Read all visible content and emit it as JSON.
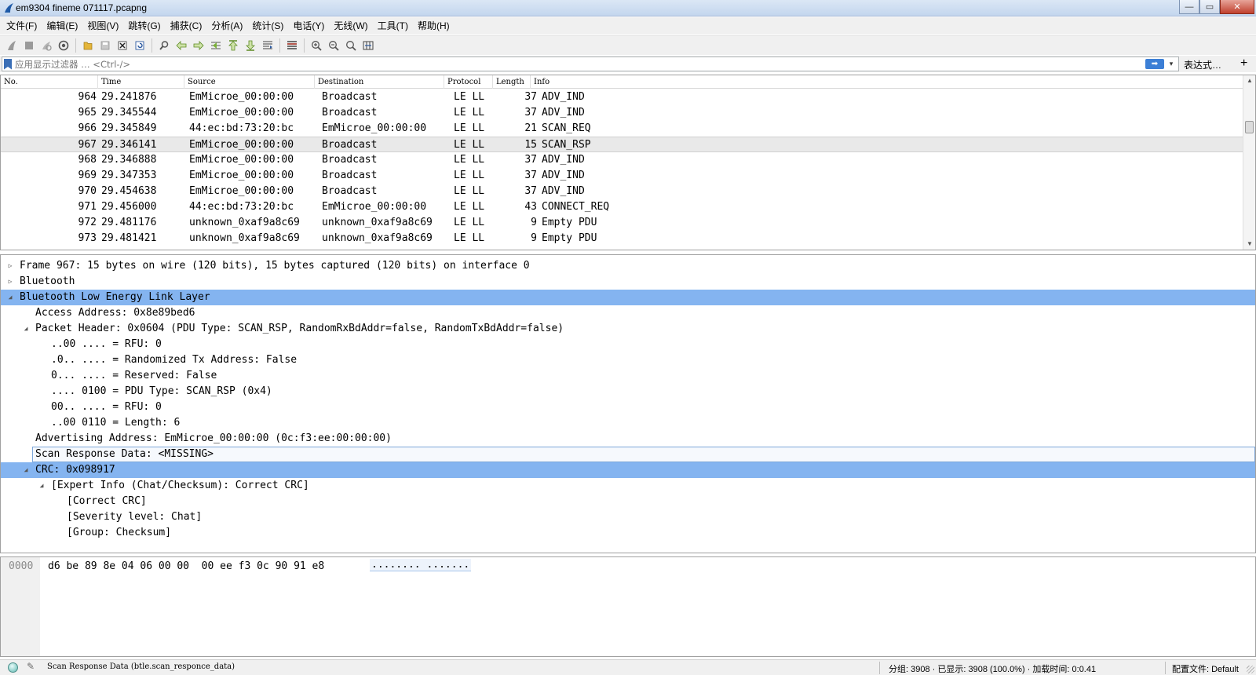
{
  "window": {
    "title": "em9304 fineme 071117.pcapng",
    "minimize": "—",
    "maximize": "▭",
    "close": "✕"
  },
  "menu": [
    "文件(F)",
    "编辑(E)",
    "视图(V)",
    "跳转(G)",
    "捕获(C)",
    "分析(A)",
    "统计(S)",
    "电话(Y)",
    "无线(W)",
    "工具(T)",
    "帮助(H)"
  ],
  "filter": {
    "placeholder": "应用显示过滤器 … <Ctrl-/>",
    "apply_label": "➡",
    "dropdown": "▾",
    "expression_label": "表达式…",
    "add_label": "+"
  },
  "packet_list": {
    "columns": [
      "No.",
      "Time",
      "Source",
      "Destination",
      "Protocol",
      "Length",
      "Info"
    ],
    "rows": [
      {
        "no": "964",
        "time": "29.241876",
        "source": "EmMicroe_00:00:00",
        "destination": "Broadcast",
        "protocol": "LE LL",
        "length": "37",
        "info": "ADV_IND"
      },
      {
        "no": "965",
        "time": "29.345544",
        "source": "EmMicroe_00:00:00",
        "destination": "Broadcast",
        "protocol": "LE LL",
        "length": "37",
        "info": "ADV_IND"
      },
      {
        "no": "966",
        "time": "29.345849",
        "source": "44:ec:bd:73:20:bc",
        "destination": "EmMicroe_00:00:00",
        "protocol": "LE LL",
        "length": "21",
        "info": "SCAN_REQ"
      },
      {
        "no": "967",
        "time": "29.346141",
        "source": "EmMicroe_00:00:00",
        "destination": "Broadcast",
        "protocol": "LE LL",
        "length": "15",
        "info": "SCAN_RSP"
      },
      {
        "no": "968",
        "time": "29.346888",
        "source": "EmMicroe_00:00:00",
        "destination": "Broadcast",
        "protocol": "LE LL",
        "length": "37",
        "info": "ADV_IND"
      },
      {
        "no": "969",
        "time": "29.347353",
        "source": "EmMicroe_00:00:00",
        "destination": "Broadcast",
        "protocol": "LE LL",
        "length": "37",
        "info": "ADV_IND"
      },
      {
        "no": "970",
        "time": "29.454638",
        "source": "EmMicroe_00:00:00",
        "destination": "Broadcast",
        "protocol": "LE LL",
        "length": "37",
        "info": "ADV_IND"
      },
      {
        "no": "971",
        "time": "29.456000",
        "source": "44:ec:bd:73:20:bc",
        "destination": "EmMicroe_00:00:00",
        "protocol": "LE LL",
        "length": "43",
        "info": "CONNECT_REQ"
      },
      {
        "no": "972",
        "time": "29.481176",
        "source": "unknown_0xaf9a8c69",
        "destination": "unknown_0xaf9a8c69",
        "protocol": "LE LL",
        "length": "9",
        "info": "Empty PDU"
      },
      {
        "no": "973",
        "time": "29.481421",
        "source": "unknown_0xaf9a8c69",
        "destination": "unknown_0xaf9a8c69",
        "protocol": "LE LL",
        "length": "9",
        "info": "Empty PDU"
      }
    ],
    "selected_no": "967"
  },
  "details": [
    {
      "text": "Frame 967: 15 bytes on wire (120 bits), 15 bytes captured (120 bits) on interface 0",
      "twisty": "▷",
      "level": 0
    },
    {
      "text": "Bluetooth",
      "twisty": "▷",
      "level": 0
    },
    {
      "text": "Bluetooth Low Energy Link Layer",
      "twisty": "◢",
      "level": 0,
      "highlight": true
    },
    {
      "text": "Access Address: 0x8e89bed6",
      "twisty": "",
      "level": 1
    },
    {
      "text": "Packet Header: 0x0604 (PDU Type: SCAN_RSP, RandomRxBdAddr=false, RandomTxBdAddr=false)",
      "twisty": "◢",
      "level": 1
    },
    {
      "text": "..00 .... = RFU: 0",
      "twisty": "",
      "level": 2
    },
    {
      "text": ".0.. .... = Randomized Tx Address: False",
      "twisty": "",
      "level": 2
    },
    {
      "text": "0... .... = Reserved: False",
      "twisty": "",
      "level": 2
    },
    {
      "text": ".... 0100 = PDU Type: SCAN_RSP (0x4)",
      "twisty": "",
      "level": 2
    },
    {
      "text": "00.. .... = RFU: 0",
      "twisty": "",
      "level": 2
    },
    {
      "text": "..00 0110 = Length: 6",
      "twisty": "",
      "level": 2
    },
    {
      "text": "Advertising Address: EmMicroe_00:00:00 (0c:f3:ee:00:00:00)",
      "twisty": "",
      "level": 1
    },
    {
      "text": "Scan Response Data: <MISSING>",
      "twisty": "",
      "level": 1,
      "focus": true
    },
    {
      "text": "CRC: 0x098917",
      "twisty": "◢",
      "level": 1,
      "highlight": true
    },
    {
      "text": "[Expert Info (Chat/Checksum): Correct CRC]",
      "twisty": "◢",
      "level": 2
    },
    {
      "text": "[Correct CRC]",
      "twisty": "",
      "level": 3
    },
    {
      "text": "[Severity level: Chat]",
      "twisty": "",
      "level": 3
    },
    {
      "text": "[Group: Checksum]",
      "twisty": "",
      "level": 3
    }
  ],
  "bytes": {
    "offset": "0000",
    "hex": "d6 be 89 8e 04 06 00 00  00 ee f3 0c 90 91 e8",
    "ascii": "........ ......."
  },
  "status": {
    "field_text": "Scan Response Data (btle.scan_responce_data)",
    "stats": "分组: 3908 · 已显示: 3908 (100.0%) · 加载时间: 0:0.41",
    "profile": "配置文件: Default"
  },
  "colors": {
    "highlight": "#84b4f0",
    "selected_row": "#e9e9e9",
    "toolbar_bg": "#f0f0f0"
  }
}
